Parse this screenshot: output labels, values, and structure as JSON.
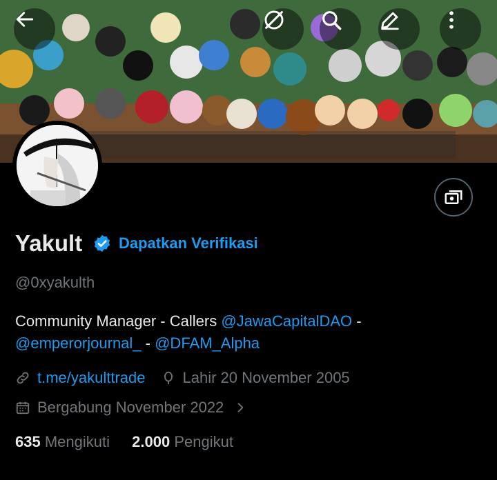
{
  "header": {
    "back": "back-arrow-icon",
    "actions": [
      "grok-icon",
      "search-icon",
      "edit-icon",
      "more-icon"
    ]
  },
  "profile": {
    "name": "Yakult",
    "get_verified": "Dapatkan Verifikasi",
    "handle": "@0xyakulth",
    "bio_text": "Community Manager - Callers ",
    "bio_link1": "@JawaCapitalDAO",
    "bio_sep1": " -",
    "bio_link2": "@emperorjournal_",
    "bio_sep2": " - ",
    "bio_link3": "@DFAM_Alpha",
    "website": "t.me/yakulttrade",
    "birthday": "Lahir 20 November 2005",
    "joined": "Bergabung November 2022"
  },
  "stats": {
    "following_count": "635",
    "following_label": "Mengikuti",
    "followers_count": "2.000",
    "followers_label": "Pengikut"
  },
  "colors": {
    "accent": "#1d9bf0",
    "muted": "#71767b",
    "text": "#e7e9ea",
    "bg": "#000000"
  }
}
